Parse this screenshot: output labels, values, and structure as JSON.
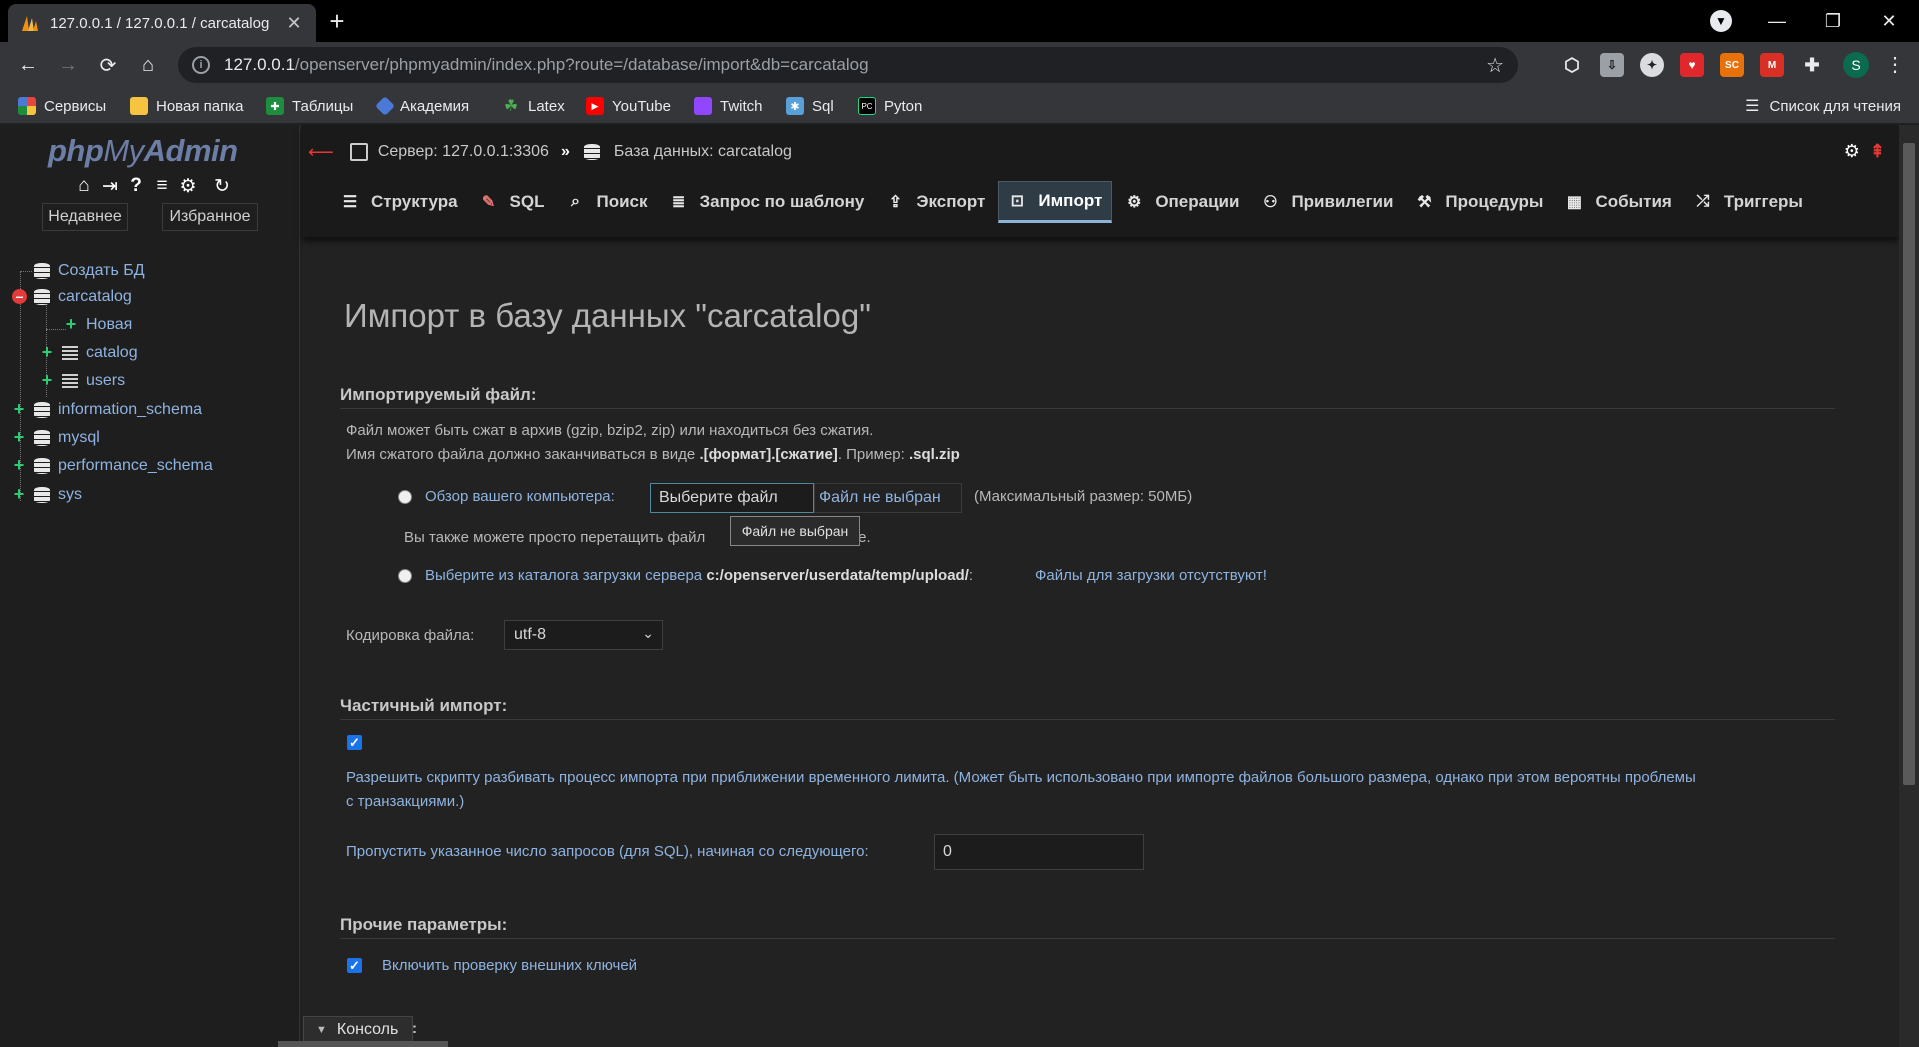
{
  "browser": {
    "tab_title": "127.0.0.1 / 127.0.0.1 / carcatalog",
    "url_host": "127.0.0.1",
    "url_path": "/openserver/phpmyadmin/index.php?route=/database/import&db=carcatalog",
    "profile_initial": "S",
    "reading_list": "Список для чтения",
    "bookmarks": [
      {
        "label": "Сервисы",
        "icon": "apps-grid-icon",
        "color": "#e8453c"
      },
      {
        "label": "Новая папка",
        "icon": "folder-icon",
        "color": "#f5c542"
      },
      {
        "label": "Таблицы",
        "icon": "sheets-icon",
        "color": "#1e8e3e"
      },
      {
        "label": "Академия",
        "icon": "academy-icon",
        "color": "#4a79d8"
      },
      {
        "label": "Latex",
        "icon": "latex-icon",
        "color": "#2e7d32"
      },
      {
        "label": "YouTube",
        "icon": "youtube-icon",
        "color": "#ff0000"
      },
      {
        "label": "Twitch",
        "icon": "twitch-icon",
        "color": "#9146ff"
      },
      {
        "label": "Sql",
        "icon": "sql-icon",
        "color": "#5aa0d8"
      },
      {
        "label": "Pyton",
        "icon": "pycharm-icon",
        "color": "#21d789"
      }
    ]
  },
  "nav": {
    "logo_php": "php",
    "logo_my": "My",
    "logo_admin": "Admin",
    "recent": "Недавнее",
    "favorites": "Избранное",
    "tree": {
      "create_db": "Создать БД",
      "db_current": "carcatalog",
      "new_table": "Новая",
      "tables": [
        "catalog",
        "users"
      ],
      "other_dbs": [
        "information_schema",
        "mysql",
        "performance_schema",
        "sys"
      ]
    }
  },
  "main": {
    "breadcrumb_server": "Сервер: 127.0.0.1:3306",
    "breadcrumb_sep": "»",
    "breadcrumb_db": "База данных: carcatalog",
    "tabs": [
      {
        "label": "Структура",
        "icon": "structure-icon"
      },
      {
        "label": "SQL",
        "icon": "sql-icon"
      },
      {
        "label": "Поиск",
        "icon": "search-icon"
      },
      {
        "label": "Запрос по шаблону",
        "icon": "query-icon"
      },
      {
        "label": "Экспорт",
        "icon": "export-icon"
      },
      {
        "label": "Импорт",
        "icon": "import-icon",
        "active": true
      },
      {
        "label": "Операции",
        "icon": "gear-icon"
      },
      {
        "label": "Привилегии",
        "icon": "users-icon"
      },
      {
        "label": "Процедуры",
        "icon": "routines-icon"
      },
      {
        "label": "События",
        "icon": "calendar-icon"
      },
      {
        "label": "Триггеры",
        "icon": "shuffle-icon"
      }
    ],
    "title": "Импорт в базу данных \"carcatalog\"",
    "file_section": {
      "legend": "Импортируемый файл:",
      "line1": "Файл может быть сжат в архив (gzip, bzip2, zip) или находиться без сжатия.",
      "line2_prefix": "Имя сжатого файла должно заканчиваться в виде ",
      "line2_format": ".[формат].[сжатие]",
      "line2_mid": ". Пример: ",
      "line2_example": ".sql.zip",
      "browse_label": "Обзор вашего компьютера:",
      "choose_file": "Выберите файл",
      "no_file": "Файл не выбран",
      "max_size": "(Максимальный размер: 50МБ)",
      "tooltip": "Файл не выбран",
      "drag_hint_prefix": "Вы также можете просто перетащить файл",
      "drag_hint_suffix": "ице.",
      "server_label": "Выберите из каталога загрузки сервера",
      "server_path": "c:/openserver/userdata/temp/upload/",
      "server_colon": ":",
      "no_files": "Файлы для загрузки отсутствуют!",
      "charset_label": "Кодировка файла:",
      "charset_value": "utf-8"
    },
    "partial_section": {
      "legend": "Частичный импорт:",
      "allow_interrupt_line1": "Разрешить скрипту разбивать процесс импорта при приближении временного лимита. (Может быть использовано при импорте файлов большого размера, однако при этом вероятны проблемы",
      "allow_interrupt_line2": "с транзакциями.)",
      "skip_label": "Пропустить указанное число запросов (для SQL), начиная со следующего:",
      "skip_value": "0"
    },
    "other_section": {
      "legend": "Прочие параметры:",
      "fk_checks": "Включить проверку внешних ключей",
      "partial_next": ":"
    },
    "console": "Консоль"
  }
}
